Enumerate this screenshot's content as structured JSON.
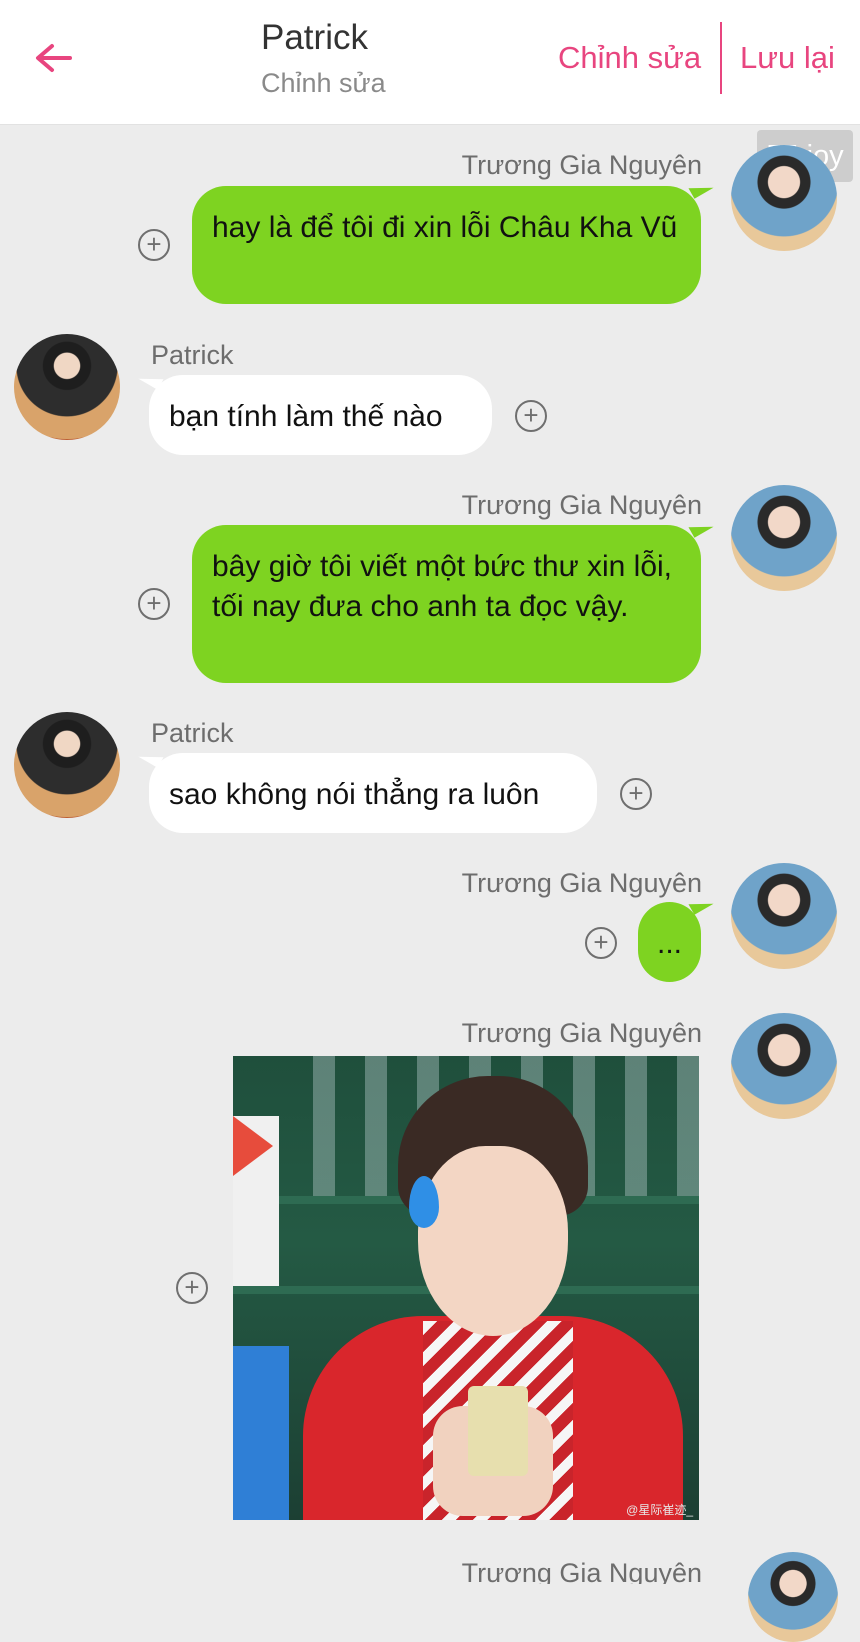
{
  "header": {
    "title": "Patrick",
    "subtitle": "Chỉnh sửa",
    "edit_label": "Chỉnh sửa",
    "save_label": "Lưu lại",
    "accent": "#e8457f"
  },
  "watermark": "55 joy",
  "messages": [
    {
      "sender": "Trương Gia Nguyên",
      "side": "right",
      "text": "hay là để tôi đi xin lỗi Châu Kha Vũ"
    },
    {
      "sender": "Patrick",
      "side": "left",
      "text": "bạn tính làm thế nào"
    },
    {
      "sender": "Trương Gia Nguyên",
      "side": "right",
      "text": "bây giờ tôi viết một bức thư xin lỗi, tối nay đưa cho anh ta đọc vậy."
    },
    {
      "sender": "Patrick",
      "side": "left",
      "text": "sao không nói thẳng ra luôn"
    },
    {
      "sender": "Trương Gia Nguyên",
      "side": "right",
      "text": "..."
    },
    {
      "sender": "Trương Gia Nguyên",
      "side": "right",
      "image_watermark": "@星际崔迹_"
    }
  ],
  "partial_sender": "Trương Gia Nguyên",
  "colors": {
    "my_bubble": "#7ed321",
    "their_bubble": "#ffffff",
    "background": "#ececec"
  }
}
